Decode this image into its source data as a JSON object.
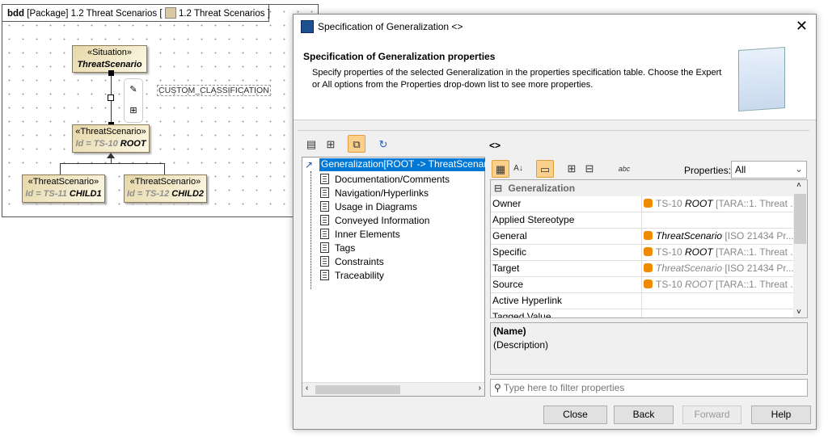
{
  "diagram": {
    "kind": "bdd",
    "header": "[Package]  1.2 Threat Scenarios [",
    "header_ref": "1.2 Threat Scenarios ]",
    "custom_label": "CUSTOM_CLASSIFICATION",
    "blocks": [
      {
        "stereotype": "«Situation»",
        "name": "ThreatScenario",
        "id": ""
      },
      {
        "stereotype": "«ThreatScenario»",
        "id": "Id = TS-10",
        "name": "ROOT"
      },
      {
        "stereotype": "«ThreatScenario»",
        "id": "Id = TS-11",
        "name": "CHILD1"
      },
      {
        "stereotype": "«ThreatScenario»",
        "id": "Id = TS-12",
        "name": "CHILD2"
      }
    ]
  },
  "dialog": {
    "title": "Specification of Generalization <>",
    "heading": "Specification of Generalization properties",
    "description": "Specify properties of the selected Generalization in the properties specification table. Choose the Expert or All options from the Properties drop-down list to see more properties.",
    "element_title": "<>",
    "tree": [
      "Generalization[ROOT -> ThreatScenario]",
      "Documentation/Comments",
      "Navigation/Hyperlinks",
      "Usage in Diagrams",
      "Conveyed Information",
      "Inner Elements",
      "Tags",
      "Constraints",
      "Traceability"
    ],
    "properties_label": "Properties:",
    "properties_value": "All",
    "group": "Generalization",
    "rows": [
      {
        "key": "Owner",
        "pre": "TS-10 ",
        "bold": "ROOT",
        "post": " [TARA::1. Threat ..."
      },
      {
        "key": "Applied Stereotype",
        "pre": "",
        "bold": "",
        "post": ""
      },
      {
        "key": "General",
        "pre": "",
        "bold": "ThreatScenario",
        "post": " [ISO 21434 Pr..."
      },
      {
        "key": "Specific",
        "pre": "TS-10 ",
        "bold": "ROOT",
        "post": " [TARA::1. Threat ..."
      },
      {
        "key": "Target",
        "pre": "",
        "bold": "ThreatScenario",
        "post": " [ISO 21434 Pr..."
      },
      {
        "key": "Source",
        "pre": "TS-10 ",
        "bold": "ROOT",
        "post": " [TARA::1. Threat ..."
      },
      {
        "key": "Active Hyperlink",
        "pre": "",
        "bold": "",
        "post": ""
      },
      {
        "key": "Tagged Value",
        "pre": "",
        "bold": "",
        "post": ""
      }
    ],
    "desc_name": "(Name)",
    "desc_text": "(Description)",
    "filter_placeholder": "Type here to filter properties",
    "buttons": {
      "close": "Close",
      "back": "Back",
      "forward": "Forward",
      "help": "Help"
    }
  }
}
